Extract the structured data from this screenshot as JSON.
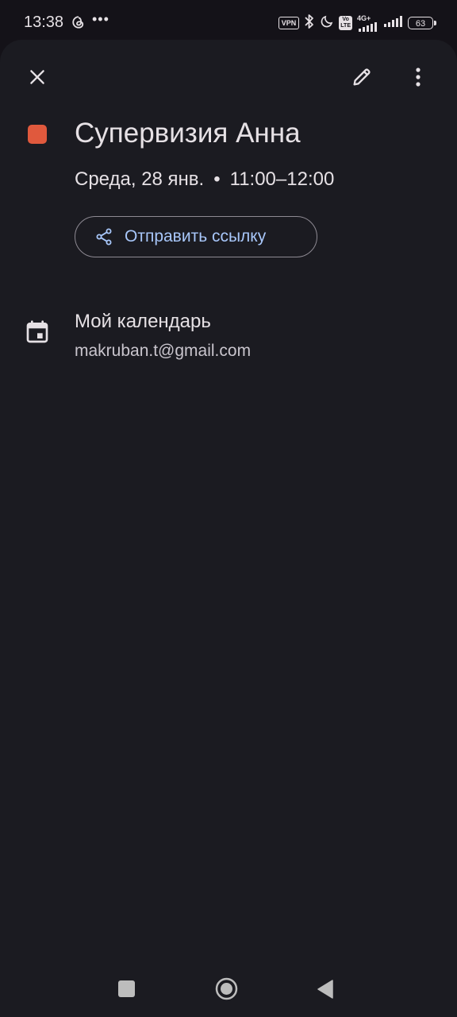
{
  "status_bar": {
    "time": "13:38",
    "more_indicator": "•••",
    "vpn_label": "VPN",
    "volte_label": "Vo\nLTE",
    "network_label": "4G+",
    "battery_level": "63",
    "icons": [
      "threads-icon",
      "vpn-icon",
      "bluetooth-icon",
      "do-not-disturb-icon",
      "volte-icon",
      "signal-icon",
      "signal-icon",
      "battery-icon"
    ]
  },
  "header": {
    "close_icon": "close-icon",
    "edit_icon": "edit-pencil-icon",
    "more_icon": "more-vert-icon"
  },
  "event": {
    "title": "Супервизия Анна",
    "color": "#e0593d",
    "date": "Среда, 28 янв.",
    "separator": "•",
    "time_range": "11:00–12:00",
    "share_label": "Отправить ссылку",
    "share_icon": "share-icon"
  },
  "calendar": {
    "icon": "calendar-event-icon",
    "name": "Мой календарь",
    "account": "makruban.t@gmail.com"
  },
  "nav_bar": {
    "recent_icon": "recent-apps-icon",
    "home_icon": "home-icon",
    "back_icon": "back-icon"
  },
  "colors": {
    "background": "#141218",
    "sheet": "#1b1b21",
    "accent_text": "#a8c7fa",
    "primary_text": "#e6e1e5"
  }
}
